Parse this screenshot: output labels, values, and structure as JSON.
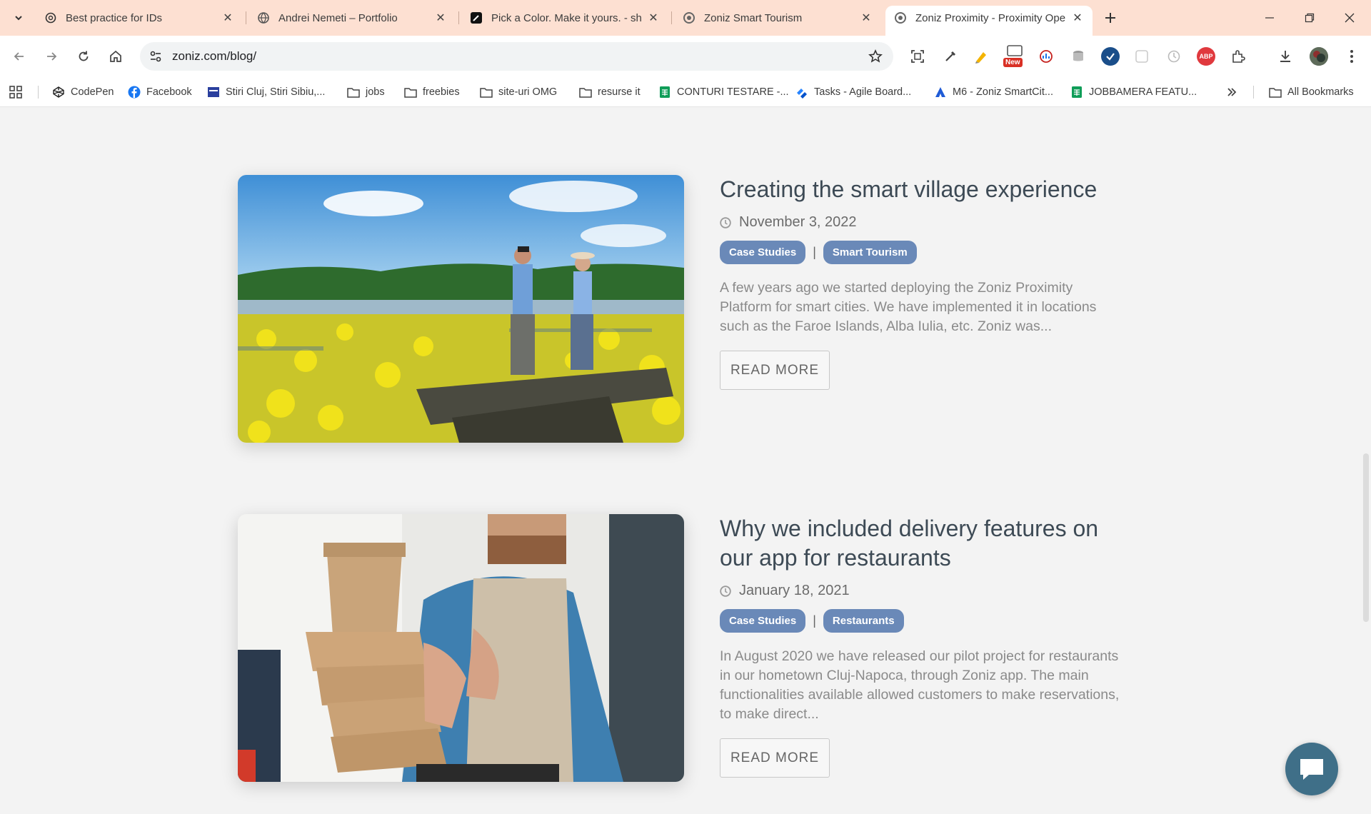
{
  "tabs": [
    {
      "title": "Best practice for IDs",
      "favicon": "openai-icon"
    },
    {
      "title": "Andrei Nemeti – Portfolio",
      "favicon": "globe-icon"
    },
    {
      "title": "Pick a Color. Make it yours. - sh",
      "favicon": "pen-icon"
    },
    {
      "title": "Zoniz Smart Tourism",
      "favicon": "zoniz-icon"
    },
    {
      "title": "Zoniz Proximity - Proximity Ope",
      "favicon": "zoniz-icon",
      "active": true
    }
  ],
  "toolbar": {
    "url": "zoniz.com/blog/",
    "new_badge": "New"
  },
  "bookmarks": [
    {
      "label": "CodePen",
      "icon": "codepen-icon"
    },
    {
      "label": "Facebook",
      "icon": "facebook-icon"
    },
    {
      "label": "Stiri Cluj, Stiri Sibiu,...",
      "icon": "news-icon"
    },
    {
      "label": "jobs",
      "icon": "folder-icon"
    },
    {
      "label": "freebies",
      "icon": "folder-icon"
    },
    {
      "label": "site-uri OMG",
      "icon": "folder-icon"
    },
    {
      "label": "resurse it",
      "icon": "folder-icon"
    },
    {
      "label": "CONTURI TESTARE -...",
      "icon": "sheets-icon"
    },
    {
      "label": "Tasks - Agile Board...",
      "icon": "jira-icon"
    },
    {
      "label": "M6 - Zoniz SmartCit...",
      "icon": "atlassian-icon"
    },
    {
      "label": "JOBBAMERA FEATU...",
      "icon": "sheets-icon"
    }
  ],
  "all_bookmarks_label": "All Bookmarks",
  "posts": [
    {
      "title": "Creating the smart village experience",
      "date": "November 3, 2022",
      "tags": [
        "Case Studies",
        "Smart Tourism"
      ],
      "tag_separator": "|",
      "excerpt": "A few years ago we started deploying the Zoniz Proximity Platform for smart cities. We have implemented it in locations such as the Faroe Islands, Alba Iulia, etc. Zoniz was...",
      "read_more": "READ MORE"
    },
    {
      "title": "Why we included delivery features on our app for restaurants",
      "date": "January 18, 2021",
      "tags": [
        "Case Studies",
        "Restaurants"
      ],
      "tag_separator": "|",
      "excerpt": "In August 2020 we have released our pilot project for restaurants in our hometown Cluj-Napoca, through Zoniz app. The main functionalities available allowed customers to make reservations, to make direct...",
      "read_more": "READ MORE"
    }
  ],
  "colors": {
    "tab_strip": "#fde0d2",
    "tag_background": "#6a89b8",
    "title_text": "#3d4a55",
    "chat_button": "#3f6f88"
  }
}
